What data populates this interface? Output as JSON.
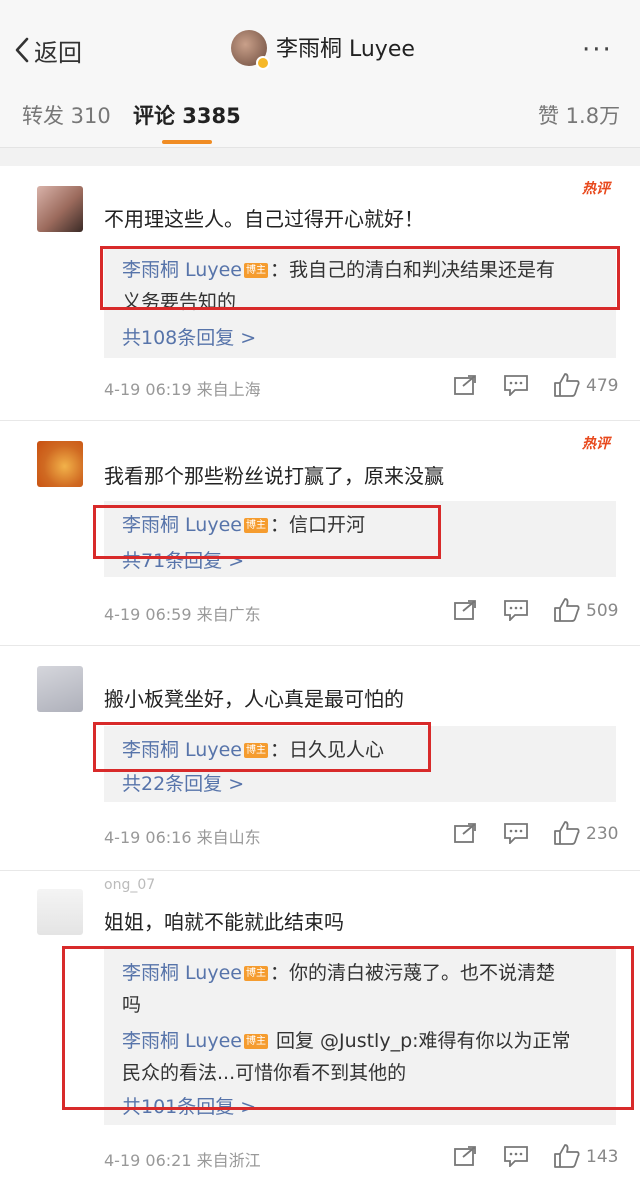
{
  "header": {
    "back_label": "返回",
    "title": "李雨桐 Luyee",
    "more": "···"
  },
  "tabs": [
    {
      "label": "转发 310"
    },
    {
      "label": "评论 3385"
    },
    {
      "label": "赞 1.8万"
    }
  ],
  "badge_label": "博主",
  "hot_label": "热评",
  "comments": [
    {
      "text": "不用理这些人。自己过得开心就好！",
      "replies": [
        {
          "author": "李雨桐 Luyee",
          "text": "：我自己的清白和判决结果还是有",
          "text2": "义务要告知的"
        }
      ],
      "more_replies": "共108条回复 >",
      "time": "4-19 06:19",
      "source": "来自上海",
      "likes": "479",
      "hot": true
    },
    {
      "text": "我看那个那些粉丝说打赢了，原来没赢",
      "replies": [
        {
          "author": "李雨桐 Luyee",
          "text": "：信口开河"
        }
      ],
      "more_replies": "共71条回复 >",
      "time": "4-19 06:59",
      "source": "来自广东",
      "likes": "509",
      "hot": true
    },
    {
      "text": "搬小板凳坐好，人心真是最可怕的",
      "replies": [
        {
          "author": "李雨桐 Luyee",
          "text": "：日久见人心"
        }
      ],
      "more_replies": "共22条回复 >",
      "time": "4-19 06:16",
      "source": "来自山东",
      "likes": "230",
      "hot": false
    },
    {
      "username": "ong_07",
      "text": "姐姐，咱就不能就此结束吗",
      "replies": [
        {
          "author": "李雨桐 Luyee",
          "text": "：你的清白被污蔑了。也不说清楚",
          "text2": "吗"
        },
        {
          "author": "李雨桐 Luyee",
          "text": " 回复 @Justly_p:难得有你以为正常",
          "text2": "民众的看法...可惜你看不到其他的"
        }
      ],
      "more_replies": "共101条回复 >",
      "time": "4-19 06:21",
      "source": "来自浙江",
      "likes": "143",
      "hot": false
    }
  ],
  "colors": {
    "link": "#5774aa",
    "accent": "#f08c24",
    "badge": "#f59c2f",
    "highlight": "#d82a2a",
    "hot": "#e8491d"
  },
  "icons": [
    "back-chevron-icon",
    "more-dots-icon",
    "share-icon",
    "comment-icon",
    "like-icon"
  ]
}
